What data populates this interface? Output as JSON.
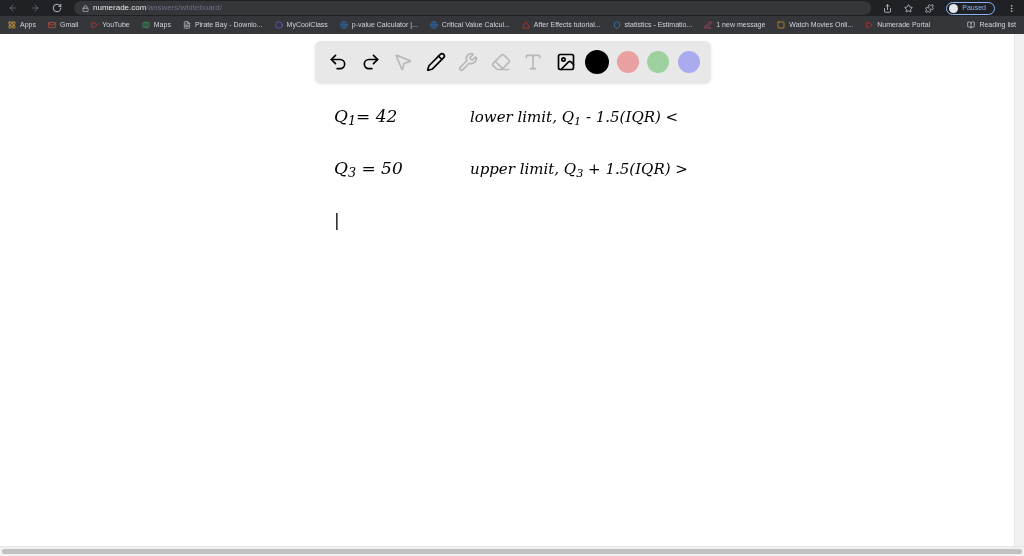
{
  "browser": {
    "url_host": "numerade.com",
    "url_path": "/answers/whiteboard/",
    "profile": "Paused",
    "bookmarks": [
      {
        "label": "Apps",
        "kind": "grid"
      },
      {
        "label": "Gmail",
        "kind": "mail"
      },
      {
        "label": "YouTube",
        "kind": "play"
      },
      {
        "label": "Maps",
        "kind": "map"
      },
      {
        "label": "Pirate Bay - Downlo...",
        "kind": "page"
      },
      {
        "label": "MyCoolClass",
        "kind": "dot"
      },
      {
        "label": "p-value Calculator |...",
        "kind": "globe"
      },
      {
        "label": "Critical Value Calcul...",
        "kind": "globe"
      },
      {
        "label": "After Effects tutorial...",
        "kind": "triangle"
      },
      {
        "label": "statistics - Estimatio...",
        "kind": "shield"
      },
      {
        "label": "1 new message",
        "kind": "pen"
      },
      {
        "label": "Watch Movies Onli...",
        "kind": "square"
      },
      {
        "label": "Numerade Portal",
        "kind": "play"
      }
    ],
    "reading_list": "Reading list"
  },
  "toolbar": {
    "tools": [
      {
        "kind": "undo",
        "disabled": false
      },
      {
        "kind": "redo",
        "disabled": false
      },
      {
        "kind": "select",
        "disabled": true
      },
      {
        "kind": "pen",
        "disabled": false
      },
      {
        "kind": "tools",
        "disabled": true
      },
      {
        "kind": "eraser",
        "disabled": true
      },
      {
        "kind": "text",
        "disabled": true
      },
      {
        "kind": "image",
        "disabled": false
      }
    ],
    "colors": [
      {
        "color": "#000000",
        "selected": true
      },
      {
        "color": "#e8a0a0",
        "selected": false
      },
      {
        "color": "#9fd09f",
        "selected": false
      },
      {
        "color": "#aaaaee",
        "selected": false
      }
    ]
  },
  "board": {
    "lines": [
      {
        "left": "Q$_{1}$= 42",
        "right": "lower limit, Q$_{1}$ - 1.5(IQR) <"
      },
      {
        "left": "Q$_{3}$ = 50",
        "right": "upper limit, Q$_{3}$ + 1.5(IQR) >"
      },
      {
        "left": "|"
      }
    ]
  }
}
